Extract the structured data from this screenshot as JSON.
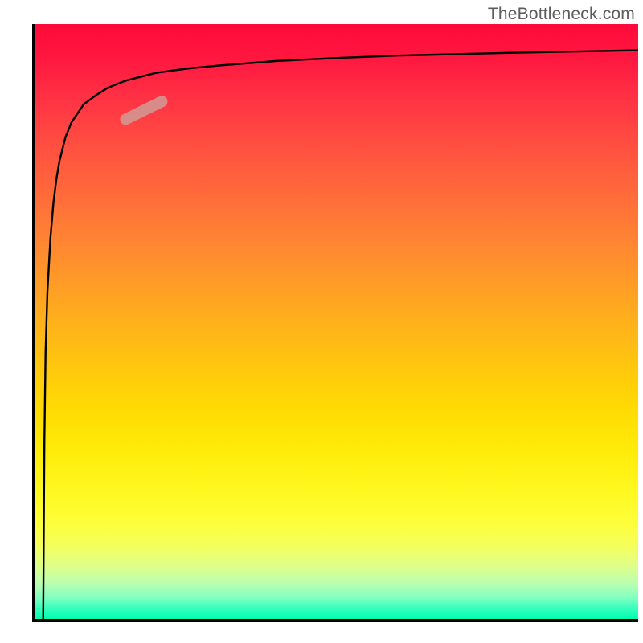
{
  "watermark": "TheBottleneck.com",
  "chart_data": {
    "type": "line",
    "title": "",
    "xlabel": "",
    "ylabel": "",
    "x_range": [
      0,
      100
    ],
    "y_range": [
      0,
      100
    ],
    "series": [
      {
        "name": "curve",
        "x": [
          1.3,
          1.5,
          1.7,
          2,
          2.5,
          3,
          3.5,
          4,
          5,
          6,
          8,
          10,
          12,
          15,
          20,
          25,
          30,
          40,
          50,
          60,
          80,
          100
        ],
        "y": [
          0,
          30,
          45,
          55,
          64,
          70,
          74,
          77,
          81,
          83.5,
          86.5,
          88,
          89.3,
          90.5,
          91.8,
          92.5,
          93,
          93.8,
          94.3,
          94.7,
          95.2,
          95.6
        ]
      },
      {
        "name": "highlight-segment",
        "x": [
          15,
          21
        ],
        "y": [
          84,
          87
        ]
      }
    ],
    "gradient_stops": [
      {
        "pos": 0,
        "color": "#ff0a3a"
      },
      {
        "pos": 50,
        "color": "#ffaa1f"
      },
      {
        "pos": 80,
        "color": "#fdff3a"
      },
      {
        "pos": 100,
        "color": "#00ffb0"
      }
    ]
  }
}
